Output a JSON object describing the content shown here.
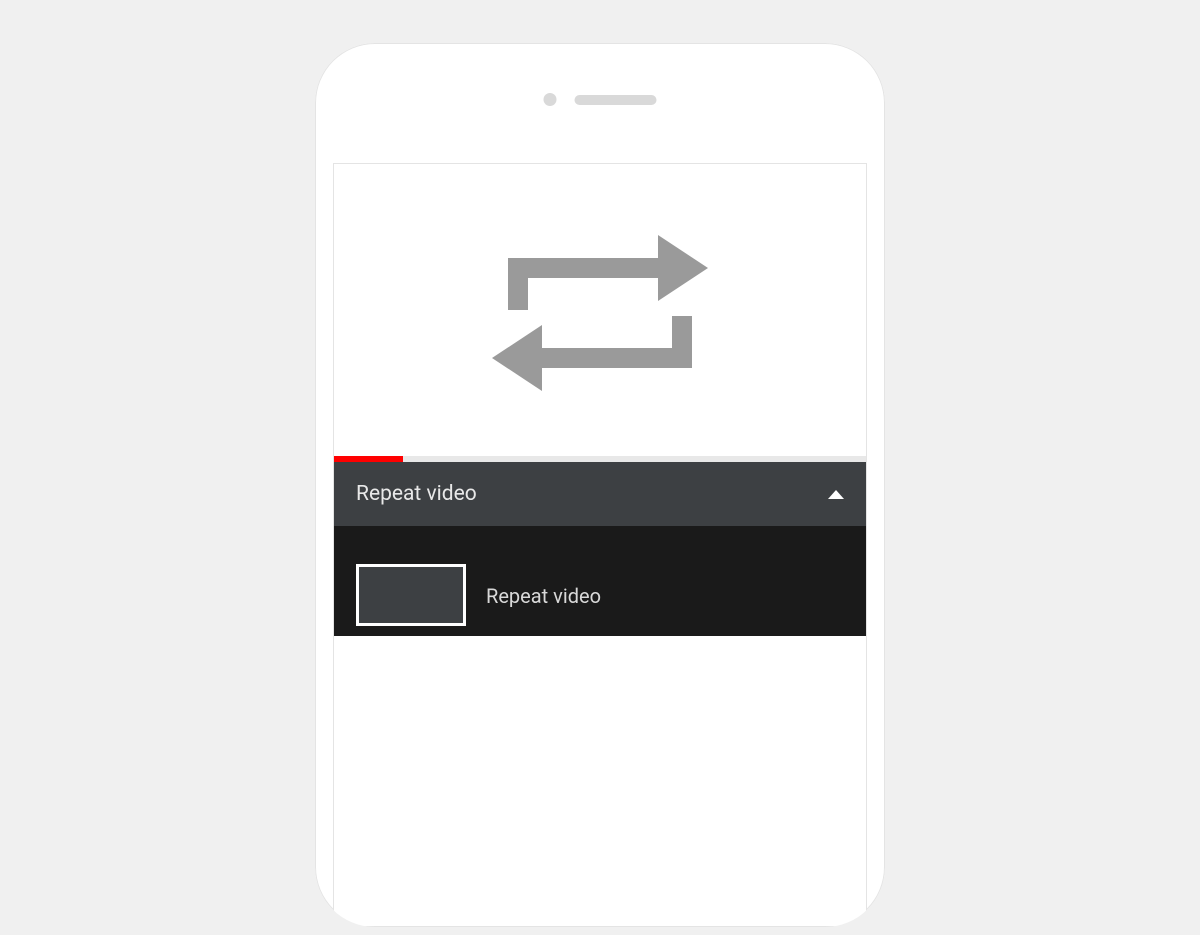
{
  "header": {
    "title": "Repeat video"
  },
  "playlist": {
    "items": [
      {
        "title": "Repeat video"
      }
    ]
  },
  "progress": {
    "percent": 13
  },
  "colors": {
    "accent": "#ff0000",
    "headerBg": "#3d4043",
    "listBg": "#1a1a1a"
  }
}
